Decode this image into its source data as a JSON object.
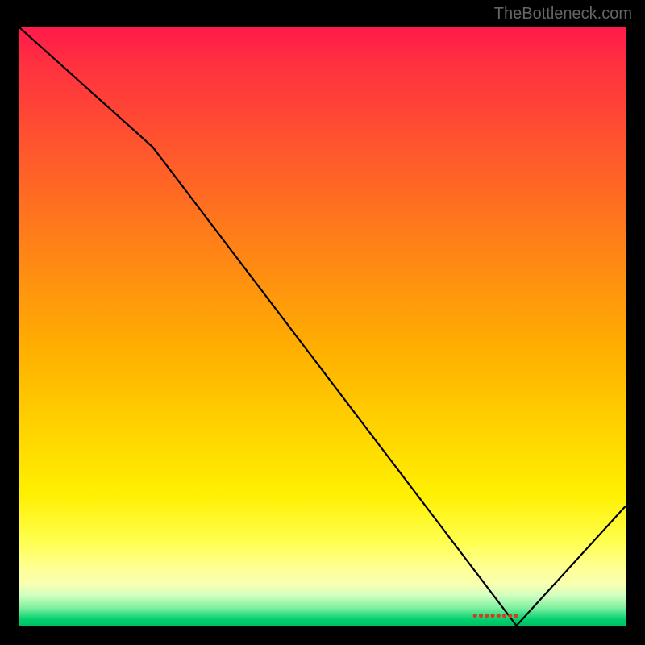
{
  "attribution": "TheBottleneck.com",
  "chart_data": {
    "type": "line",
    "title": "",
    "xlabel": "",
    "ylabel": "",
    "xlim": [
      0,
      100
    ],
    "ylim": [
      0,
      100
    ],
    "x": [
      0,
      22,
      82,
      100
    ],
    "values": [
      100,
      80,
      0,
      20
    ],
    "annotation_x": 82,
    "gradient_stops": [
      {
        "pct": 0,
        "color": "#ff1a4b"
      },
      {
        "pct": 50,
        "color": "#ffb000"
      },
      {
        "pct": 90,
        "color": "#ffff90"
      },
      {
        "pct": 100,
        "color": "#00c060"
      }
    ]
  },
  "marker_text": "●●●●●●●●"
}
